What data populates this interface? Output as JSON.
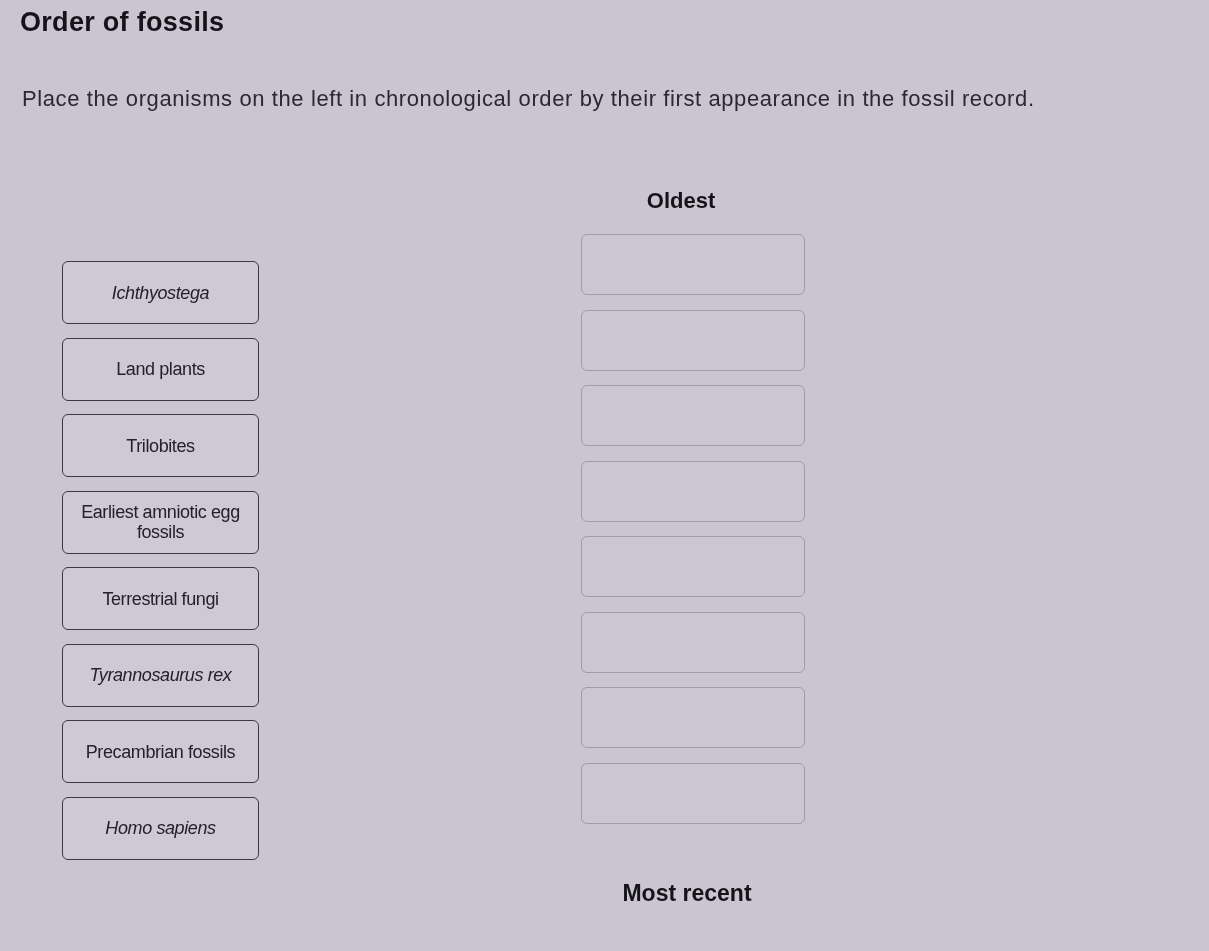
{
  "title": "Order of fossils",
  "instruction": "Place the organisms on the left in chronological order by their first appearance in the fossil record.",
  "organisms": [
    {
      "label": "Ichthyostega",
      "italic": true
    },
    {
      "label": "Land plants",
      "italic": false
    },
    {
      "label": "Trilobites",
      "italic": false
    },
    {
      "label": "Earliest amniotic egg fossils",
      "italic": false
    },
    {
      "label": "Terrestrial fungi",
      "italic": false
    },
    {
      "label": "Tyrannosaurus rex",
      "italic": true
    },
    {
      "label": "Precambrian fossils",
      "italic": false
    },
    {
      "label": "Homo sapiens",
      "italic": true
    }
  ],
  "order": {
    "top_label": "Oldest",
    "slots": [
      {
        "kind": "empty"
      },
      {
        "kind": "empty"
      },
      {
        "kind": "empty"
      },
      {
        "kind": "empty"
      },
      {
        "kind": "empty"
      },
      {
        "kind": "empty"
      },
      {
        "kind": "empty"
      },
      {
        "kind": "empty"
      }
    ],
    "bottom_label": "Most recent"
  }
}
